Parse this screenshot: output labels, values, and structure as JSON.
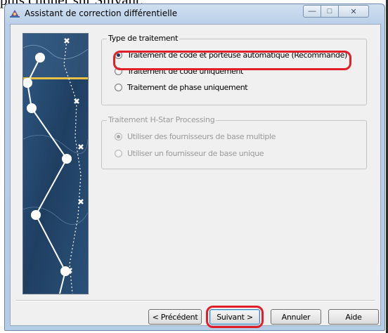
{
  "page": {
    "top_text": "puis cliquer sur Suivant."
  },
  "window": {
    "title": "Assistant de correction différentielle",
    "controls": {
      "minimize": "—",
      "maximize": "□",
      "close": "✕"
    }
  },
  "processing_type": {
    "label": "Type de traitement",
    "options": [
      {
        "label": "Traitement de code et porteuse automatique (Recommandé)",
        "selected": true
      },
      {
        "label": "Traitement de code uniquement",
        "selected": false
      },
      {
        "label": "Traitement de phase uniquement",
        "selected": false
      }
    ]
  },
  "hstar": {
    "label": "Traitement H-Star Processing",
    "enabled": false,
    "options": [
      {
        "label": "Utiliser des fournisseurs de base multiple",
        "selected": true
      },
      {
        "label": "Utiliser un fournisseur de base unique",
        "selected": false
      }
    ]
  },
  "buttons": {
    "previous": "< Précédent",
    "next": "Suivant >",
    "cancel": "Annuler",
    "help": "Aide"
  },
  "colors": {
    "highlight": "#e11f2a",
    "sidebar_background": "#24466d",
    "sidebar_accent": "#e8c043"
  },
  "icons": {
    "title": "satellite-icon",
    "sidebar": "gps-path-illustration"
  }
}
